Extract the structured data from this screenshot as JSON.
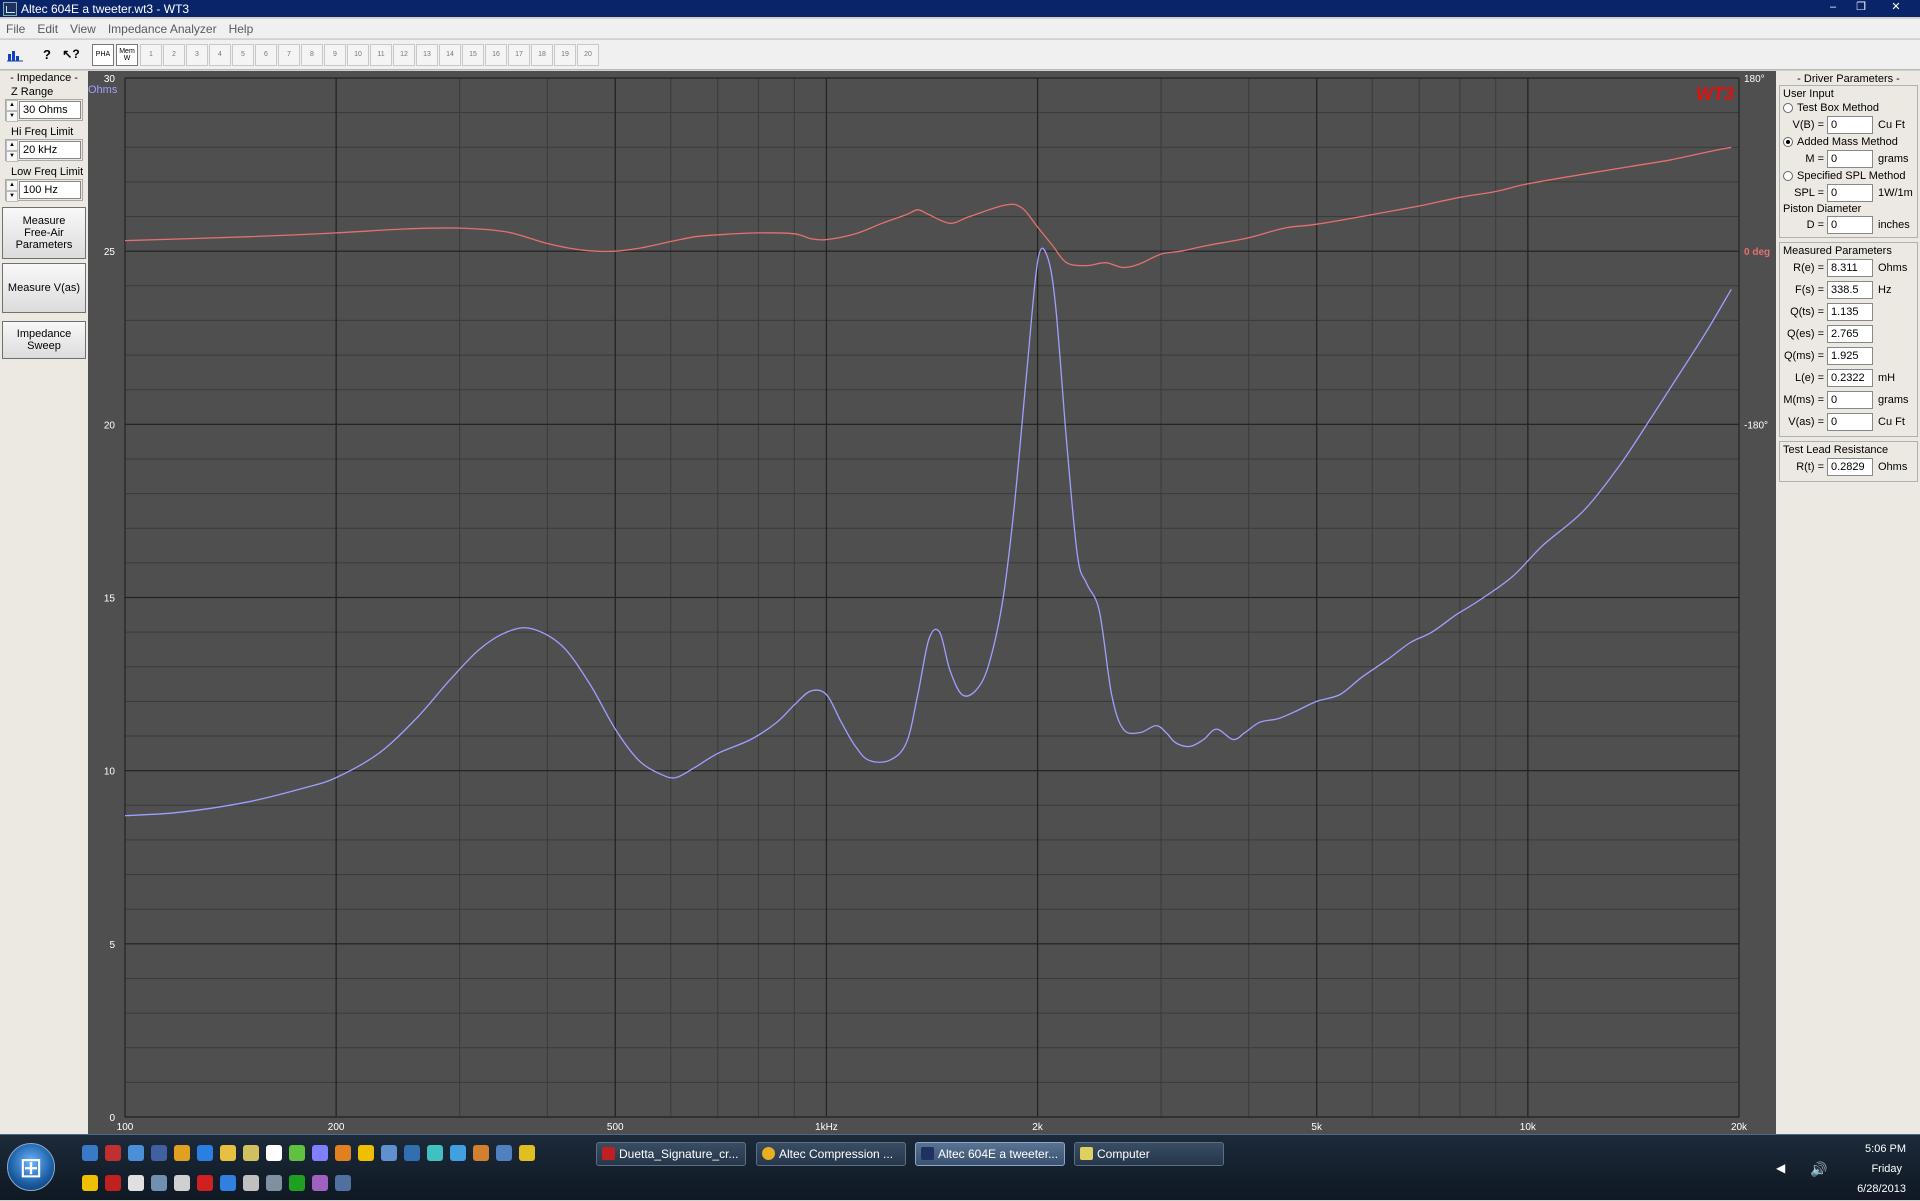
{
  "window": {
    "title": "Altec 604E a tweeter.wt3 - WT3",
    "minimize": "‒",
    "maximize": "❐",
    "close": "✕"
  },
  "menu": [
    "File",
    "Edit",
    "View",
    "Impedance Analyzer",
    "Help"
  ],
  "toolbar": {
    "buttons": [
      "graph-icon",
      "help-icon",
      "context-help-icon"
    ],
    "pha": "PHA",
    "mem_w": "Mem W",
    "mem_slots": [
      "1",
      "2",
      "3",
      "4",
      "5",
      "6",
      "7",
      "8",
      "9",
      "10",
      "11",
      "12",
      "13",
      "14",
      "15",
      "16",
      "17",
      "18",
      "19",
      "20"
    ]
  },
  "left": {
    "section": "- Impedance -",
    "z_range_label": "Z Range",
    "z_range_value": "30 Ohms",
    "hi_freq_label": "Hi Freq Limit",
    "hi_freq_value": "20 kHz",
    "low_freq_label": "Low Freq Limit",
    "low_freq_value": "100 Hz",
    "btn_measure_free_air": "Measure Free-Air Parameters",
    "btn_measure_vas": "Measure V(as)",
    "btn_impedance_sweep": "Impedance Sweep"
  },
  "right": {
    "section": "- Driver Parameters -",
    "user_input": "User Input",
    "radio_test_box": "Test Box Method",
    "vb_label": "V(B) =",
    "vb_value": "0",
    "vb_unit": "Cu Ft",
    "radio_added_mass": "Added Mass Method",
    "m_label": "M =",
    "m_value": "0",
    "m_unit": "grams",
    "radio_specified_spl": "Specified SPL Method",
    "spl_label": "SPL =",
    "spl_value": "0",
    "spl_unit": "1W/1m",
    "piston_label": "Piston Diameter",
    "d_label": "D =",
    "d_value": "0",
    "d_unit": "inches",
    "measured": "Measured Parameters",
    "params": [
      {
        "label": "R(e) =",
        "value": "8.311",
        "unit": "Ohms"
      },
      {
        "label": "F(s) =",
        "value": "338.5",
        "unit": "Hz"
      },
      {
        "label": "Q(ts) =",
        "value": "1.135",
        "unit": ""
      },
      {
        "label": "Q(es) =",
        "value": "2.765",
        "unit": ""
      },
      {
        "label": "Q(ms) =",
        "value": "1.925",
        "unit": ""
      },
      {
        "label": "L(e) =",
        "value": "0.2322",
        "unit": "mH"
      },
      {
        "label": "M(ms) =",
        "value": "0",
        "unit": "grams"
      },
      {
        "label": "V(as) =",
        "value": "0",
        "unit": "Cu Ft"
      }
    ],
    "lead_title": "Test Lead Resistance",
    "rt_label": "R(t) =",
    "rt_value": "0.2829",
    "rt_unit": "Ohms"
  },
  "chart_data": {
    "type": "line",
    "logo": "WT3",
    "y_unit_label": "Ohms",
    "y_ticks": [
      "0",
      "5",
      "10",
      "15",
      "20",
      "25",
      "30"
    ],
    "ylim": [
      0,
      30
    ],
    "x_scale": "log",
    "xlim": [
      100,
      20000
    ],
    "x_ticks": [
      {
        "value": 100,
        "label": "100"
      },
      {
        "value": 200,
        "label": "200"
      },
      {
        "value": 500,
        "label": "500"
      },
      {
        "value": 1000,
        "label": "1kHz"
      },
      {
        "value": 2000,
        "label": "2k"
      },
      {
        "value": 5000,
        "label": "5k"
      },
      {
        "value": 10000,
        "label": "10k"
      },
      {
        "value": 20000,
        "label": "20k"
      }
    ],
    "phase_ticks": [
      {
        "value": 180,
        "label": "180°"
      },
      {
        "value": 0,
        "label": "0 deg"
      },
      {
        "value": -180,
        "label": "-180°"
      }
    ],
    "phase_ylim": [
      -180,
      180
    ],
    "colors": {
      "background": "#4f4f4f",
      "major_grid": "#222222",
      "minor_grid": "#3a3a3a",
      "impedance": "#9f9fff",
      "phase": "#e47070",
      "logo": "#e01010",
      "phase_axis": "#e47070",
      "y_axis": "#9f9fff"
    },
    "series": [
      {
        "name": "Impedance",
        "axis": "left",
        "points": [
          [
            100,
            8.7
          ],
          [
            120,
            8.8
          ],
          [
            150,
            9.1
          ],
          [
            180,
            9.5
          ],
          [
            200,
            9.8
          ],
          [
            230,
            10.5
          ],
          [
            260,
            11.5
          ],
          [
            290,
            12.6
          ],
          [
            320,
            13.5
          ],
          [
            350,
            14.0
          ],
          [
            380,
            14.1
          ],
          [
            420,
            13.6
          ],
          [
            460,
            12.5
          ],
          [
            500,
            11.2
          ],
          [
            540,
            10.3
          ],
          [
            580,
            9.9
          ],
          [
            610,
            9.8
          ],
          [
            650,
            10.1
          ],
          [
            700,
            10.5
          ],
          [
            780,
            10.9
          ],
          [
            850,
            11.4
          ],
          [
            900,
            11.9
          ],
          [
            950,
            12.3
          ],
          [
            1000,
            12.2
          ],
          [
            1050,
            11.4
          ],
          [
            1100,
            10.7
          ],
          [
            1150,
            10.3
          ],
          [
            1230,
            10.3
          ],
          [
            1300,
            10.8
          ],
          [
            1350,
            12.2
          ],
          [
            1400,
            13.8
          ],
          [
            1450,
            14.0
          ],
          [
            1500,
            12.9
          ],
          [
            1560,
            12.2
          ],
          [
            1630,
            12.3
          ],
          [
            1700,
            13.0
          ],
          [
            1780,
            14.8
          ],
          [
            1850,
            17.5
          ],
          [
            1930,
            21.5
          ],
          [
            2000,
            24.7
          ],
          [
            2060,
            24.9
          ],
          [
            2120,
            23.5
          ],
          [
            2200,
            19.5
          ],
          [
            2280,
            16.2
          ],
          [
            2350,
            15.4
          ],
          [
            2450,
            14.6
          ],
          [
            2550,
            12.2
          ],
          [
            2650,
            11.2
          ],
          [
            2800,
            11.1
          ],
          [
            2950,
            11.3
          ],
          [
            3050,
            11.1
          ],
          [
            3150,
            10.8
          ],
          [
            3300,
            10.7
          ],
          [
            3450,
            10.9
          ],
          [
            3600,
            11.2
          ],
          [
            3800,
            10.9
          ],
          [
            3950,
            11.1
          ],
          [
            4150,
            11.4
          ],
          [
            4400,
            11.5
          ],
          [
            4650,
            11.7
          ],
          [
            5000,
            12.0
          ],
          [
            5400,
            12.2
          ],
          [
            5800,
            12.7
          ],
          [
            6300,
            13.2
          ],
          [
            6800,
            13.7
          ],
          [
            7300,
            14.0
          ],
          [
            7900,
            14.5
          ],
          [
            8500,
            14.9
          ],
          [
            9500,
            15.6
          ],
          [
            10500,
            16.5
          ],
          [
            12000,
            17.5
          ],
          [
            13500,
            18.8
          ],
          [
            15000,
            20.2
          ],
          [
            16500,
            21.5
          ],
          [
            18000,
            22.7
          ],
          [
            19500,
            23.9
          ]
        ]
      },
      {
        "name": "Phase",
        "axis": "right",
        "points": [
          [
            100,
            11
          ],
          [
            150,
            15
          ],
          [
            200,
            19
          ],
          [
            250,
            23
          ],
          [
            300,
            24
          ],
          [
            350,
            20
          ],
          [
            400,
            8
          ],
          [
            450,
            1
          ],
          [
            500,
            0
          ],
          [
            550,
            4
          ],
          [
            600,
            10
          ],
          [
            650,
            15
          ],
          [
            700,
            17
          ],
          [
            800,
            19
          ],
          [
            900,
            18
          ],
          [
            950,
            13
          ],
          [
            1000,
            12
          ],
          [
            1100,
            18
          ],
          [
            1200,
            29
          ],
          [
            1300,
            38
          ],
          [
            1350,
            43
          ],
          [
            1400,
            38
          ],
          [
            1500,
            29
          ],
          [
            1600,
            36
          ],
          [
            1800,
            48
          ],
          [
            1900,
            45
          ],
          [
            2000,
            25
          ],
          [
            2100,
            6
          ],
          [
            2200,
            -12
          ],
          [
            2350,
            -15
          ],
          [
            2500,
            -12
          ],
          [
            2650,
            -17
          ],
          [
            2800,
            -13
          ],
          [
            3000,
            -3
          ],
          [
            3200,
            0
          ],
          [
            3500,
            6
          ],
          [
            4000,
            14
          ],
          [
            4500,
            24
          ],
          [
            5000,
            28
          ],
          [
            6000,
            38
          ],
          [
            7000,
            47
          ],
          [
            8000,
            56
          ],
          [
            9000,
            62
          ],
          [
            10000,
            70
          ],
          [
            12000,
            80
          ],
          [
            14000,
            88
          ],
          [
            16000,
            95
          ],
          [
            18000,
            103
          ],
          [
            19500,
            108
          ]
        ]
      }
    ]
  },
  "taskbar": {
    "tasks": [
      "Duetta_Signature_cr...",
      "Altec Compression ...",
      "Altec 604E a tweeter...",
      "Computer"
    ],
    "time": "5:06 PM",
    "day": "Friday",
    "date": "6/28/2013"
  }
}
